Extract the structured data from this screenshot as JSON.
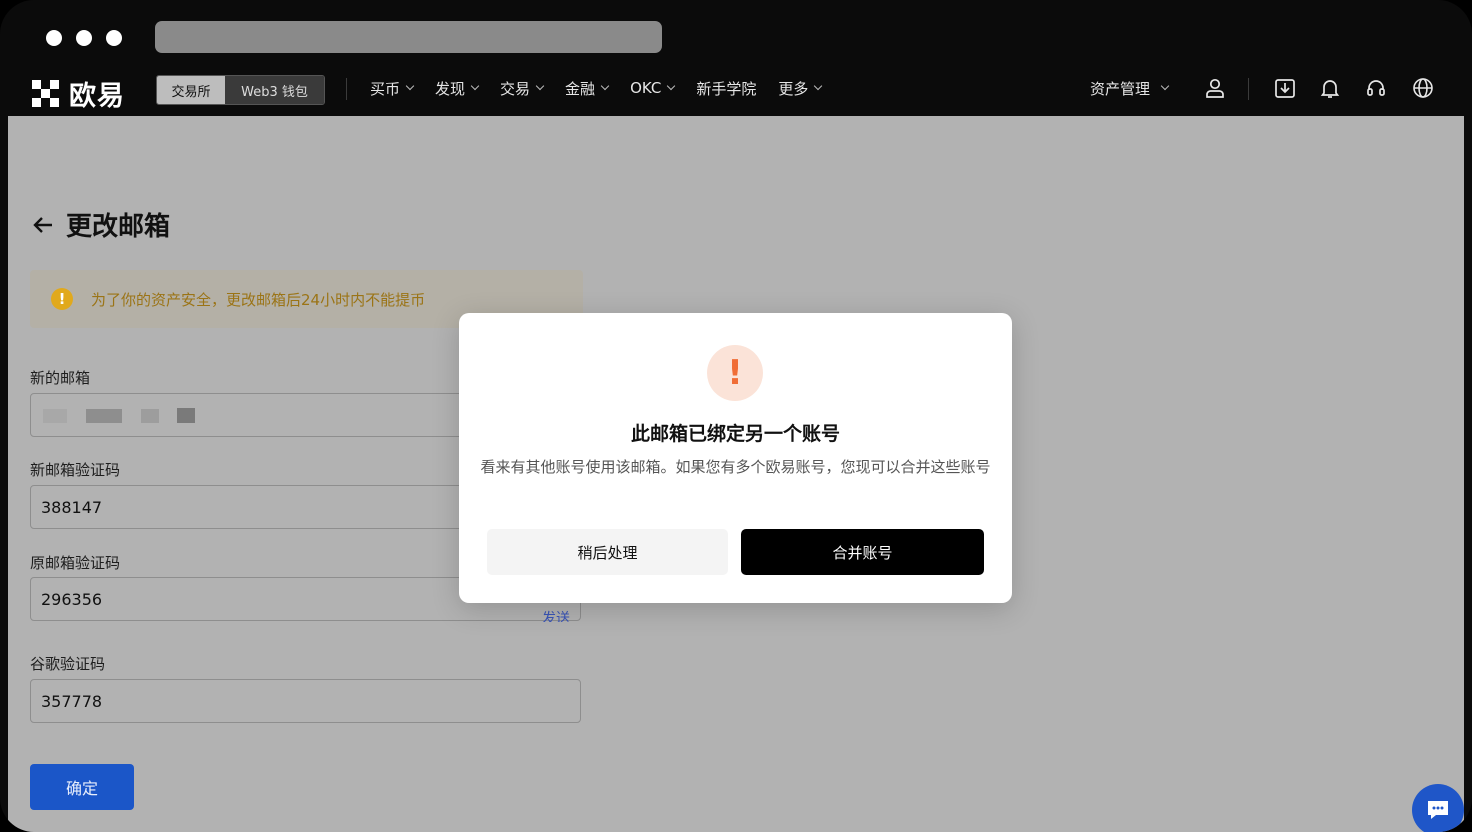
{
  "browser": {
    "dots": [
      "red",
      "yellow",
      "green"
    ]
  },
  "nav": {
    "logo_text": "欧易",
    "segment": {
      "active": "交易所",
      "inactive": "Web3 钱包"
    },
    "menu": [
      {
        "label": "买币",
        "has_dropdown": true
      },
      {
        "label": "发现",
        "has_dropdown": true
      },
      {
        "label": "交易",
        "has_dropdown": true
      },
      {
        "label": "金融",
        "has_dropdown": true
      },
      {
        "label": "OKC",
        "has_dropdown": true
      },
      {
        "label": "新手学院",
        "has_dropdown": false
      },
      {
        "label": "更多",
        "has_dropdown": true
      }
    ],
    "asset_management": "资产管理",
    "icons": [
      "user-icon",
      "download-icon",
      "bell-icon",
      "headset-icon",
      "globe-icon"
    ]
  },
  "page": {
    "title": "更改邮箱",
    "notice": "为了你的资产安全，更改邮箱后24小时内不能提币",
    "fields": [
      {
        "label": "新的邮箱",
        "value": ""
      },
      {
        "label": "新邮箱验证码",
        "value": "388147"
      },
      {
        "label": "原邮箱验证码",
        "value": "296356",
        "action": "发送"
      },
      {
        "label": "谷歌验证码",
        "value": "357778"
      }
    ],
    "confirm_label": "确定"
  },
  "modal": {
    "title": "此邮箱已绑定另一个账号",
    "description": "看来有其他账号使用该邮箱。如果您有多个欧易账号，您现可以合并这些账号",
    "secondary_button": "稍后处理",
    "primary_button": "合并账号"
  },
  "colors": {
    "brand_blue": "#1b56c8",
    "warning_orange": "#f06d36",
    "notice_yellow": "#e1a91c"
  }
}
